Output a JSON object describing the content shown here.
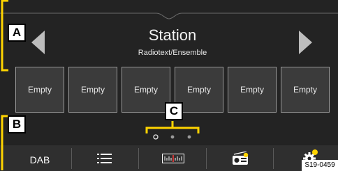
{
  "station": {
    "name": "Station",
    "info": "Radiotext/Ensemble"
  },
  "presets": [
    "Empty",
    "Empty",
    "Empty",
    "Empty",
    "Empty",
    "Empty"
  ],
  "page_indicator": {
    "pages": 3,
    "current": 1
  },
  "bottom_bar": {
    "source_label": "DAB",
    "icons": [
      "list-icon",
      "frequency-scale-icon",
      "radio-settings-icon",
      "gear-icon"
    ]
  },
  "callouts": {
    "a": "A",
    "b": "B",
    "c": "C"
  },
  "reference": "S19-0459",
  "colors": {
    "screen": "#232323",
    "tile": "#3b3b3b",
    "bar": "#2f2f2f",
    "accent": "#ffd400"
  }
}
